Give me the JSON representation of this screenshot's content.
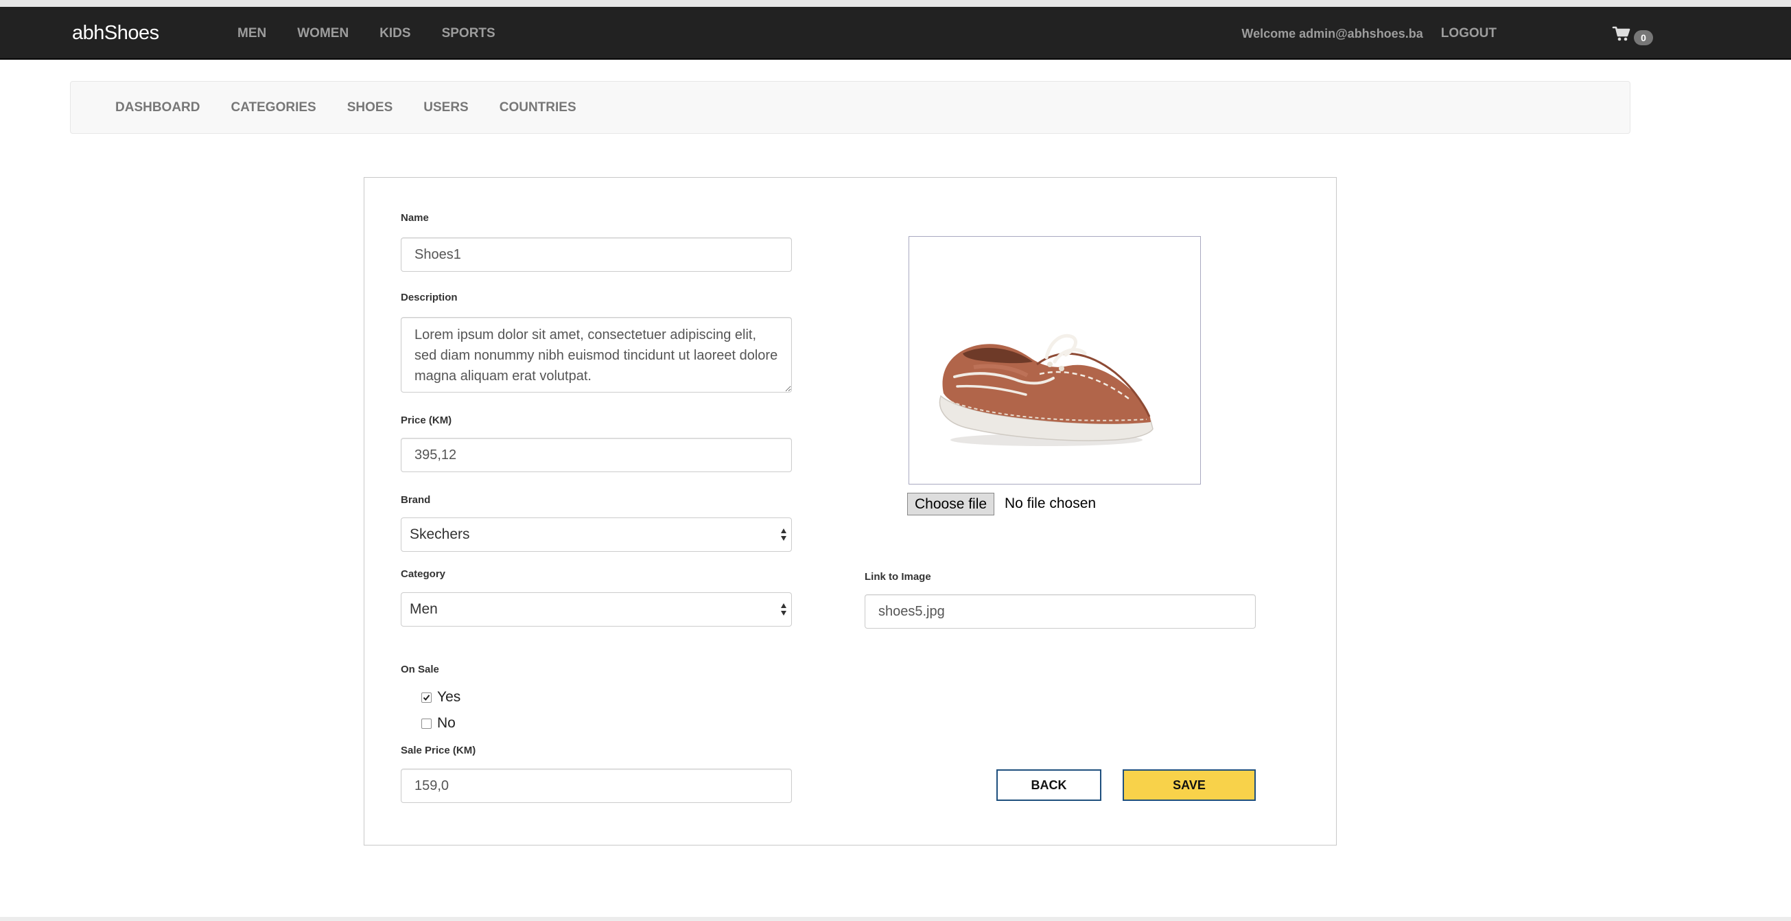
{
  "navbar": {
    "brand": "abhShoes",
    "links": [
      "MEN",
      "WOMEN",
      "KIDS",
      "SPORTS"
    ],
    "welcome": "Welcome admin@abhshoes.ba",
    "logout": "LOGOUT",
    "cart_count": "0"
  },
  "admin_nav": {
    "links": [
      "DASHBOARD",
      "CATEGORIES",
      "SHOES",
      "USERS",
      "COUNTRIES"
    ]
  },
  "form": {
    "name_label": "Name",
    "name_value": "Shoes1",
    "description_label": "Description",
    "description_value": "Lorem ipsum dolor sit amet, consectetuer adipiscing elit, sed diam nonummy nibh euismod tincidunt ut laoreet dolore magna aliquam erat volutpat.",
    "price_label": "Price (KM)",
    "price_value": "395,12",
    "brand_label": "Brand",
    "brand_value": "Skechers",
    "category_label": "Category",
    "category_value": "Men",
    "on_sale_label": "On Sale",
    "on_sale_yes": "Yes",
    "on_sale_no": "No",
    "on_sale_selected": "Yes",
    "sale_price_label": "Sale Price (KM)",
    "sale_price_value": "159,0",
    "file_button": "Choose file",
    "file_status": "No file chosen",
    "link_label": "Link to Image",
    "link_value": "shoes5.jpg",
    "back_button": "BACK",
    "save_button": "SAVE"
  },
  "colors": {
    "navbar_bg": "#222222",
    "nav_text": "#9d9d9d",
    "save_button_bg": "#f8d24a",
    "button_border": "#1e4f7d",
    "shoe_leather": "#b1654a"
  },
  "icons": {
    "cart": "shopping-cart-icon",
    "select_arrows": "updown-arrows-icon",
    "checkbox": "checkmark-icon"
  }
}
